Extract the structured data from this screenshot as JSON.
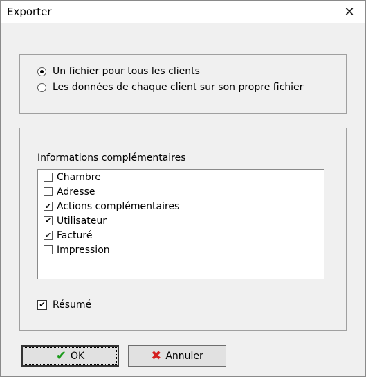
{
  "window": {
    "title": "Exporter"
  },
  "export_mode": {
    "options": [
      {
        "label": "Un fichier pour tous les clients",
        "selected": true
      },
      {
        "label": "Les données de chaque client sur son propre fichier",
        "selected": false
      }
    ]
  },
  "info": {
    "label": "Informations complémentaires",
    "items": [
      {
        "label": "Chambre",
        "checked": false
      },
      {
        "label": "Adresse",
        "checked": false
      },
      {
        "label": "Actions complémentaires",
        "checked": true
      },
      {
        "label": "Utilisateur",
        "checked": true
      },
      {
        "label": "Facturé",
        "checked": true
      },
      {
        "label": "Impression",
        "checked": false
      }
    ]
  },
  "resume": {
    "label": "Résumé",
    "checked": true
  },
  "buttons": {
    "ok_label": "OK",
    "cancel_label": "Annuler"
  },
  "icons": {
    "close": "close-icon",
    "ok": "checkmark-icon",
    "cancel": "x-icon"
  },
  "colors": {
    "ok_icon": "#1a9a1a",
    "cancel_icon": "#d42020"
  }
}
